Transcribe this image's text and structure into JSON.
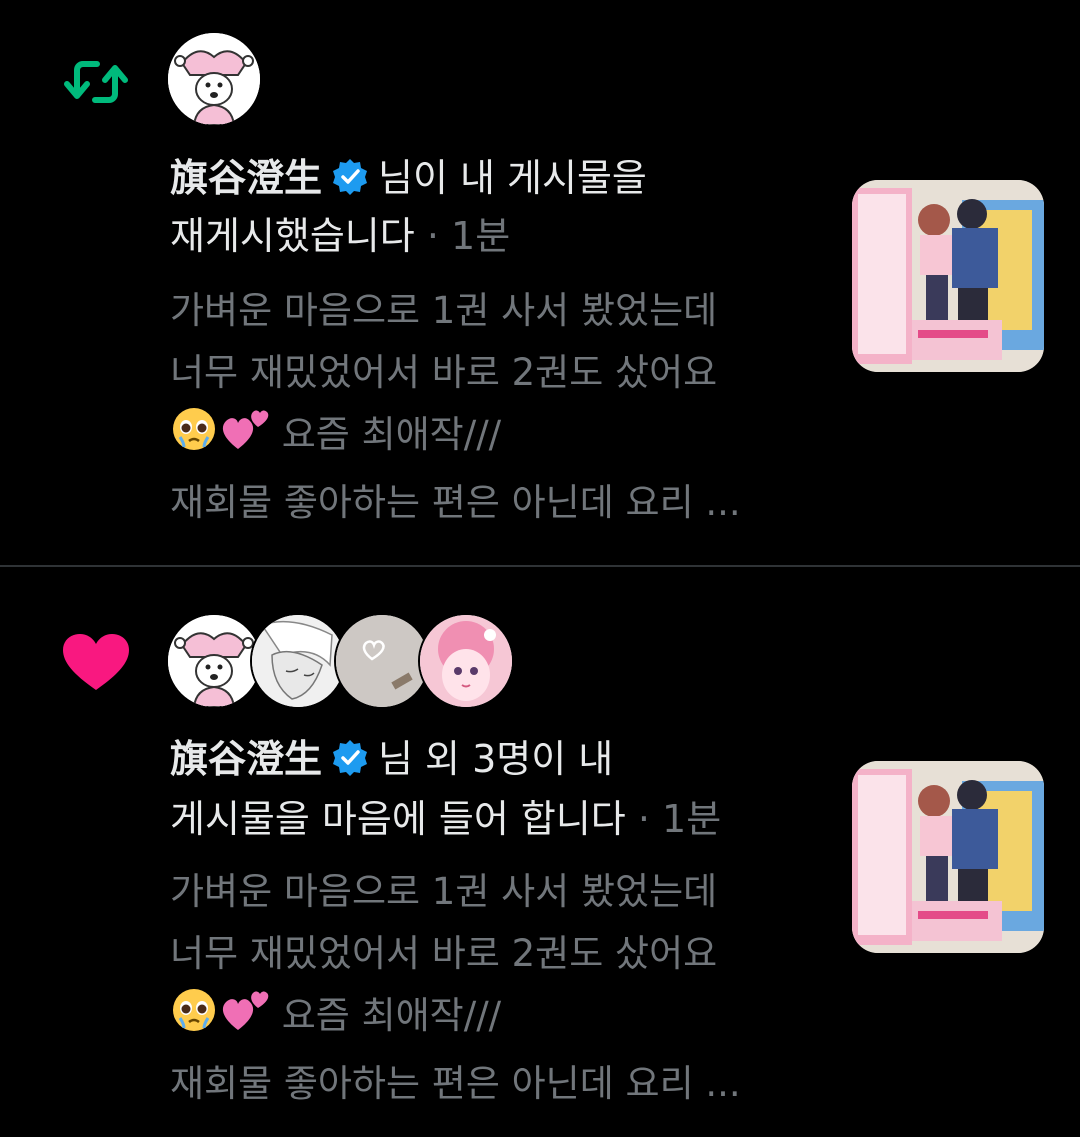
{
  "notifications": [
    {
      "type": "repost",
      "type_icon": "repost-icon",
      "actor_name": "旗谷澄生",
      "verified": true,
      "action_text_1": "님이 내 게시물을",
      "action_text_2": "재게시했습니다",
      "time": "1분",
      "preview_lines": [
        "가벼운 마음으로 1권 사서 봤었는데",
        "너무 재밌었어서 바로 2권도 샀어요",
        "요즘 최애작///",
        "재회물 좋아하는 편은 아닌데 요리 ..."
      ],
      "preview_emojis": [
        "pleading-face-emoji",
        "two-hearts-emoji"
      ]
    },
    {
      "type": "like",
      "type_icon": "heart-icon",
      "actor_name": "旗谷澄生",
      "verified": true,
      "action_text_1": "님 외 3명이 내",
      "action_text_2": "게시물을 마음에 들어 합니다",
      "time": "1분",
      "preview_lines": [
        "가벼운 마음으로 1권 사서 봤었는데",
        "너무 재밌었어서 바로 2권도 샀어요",
        "요즘 최애작///",
        "재회물 좋아하는 편은 아닌데 요리 ..."
      ],
      "preview_emojis": [
        "pleading-face-emoji",
        "two-hearts-emoji"
      ]
    }
  ],
  "separator": "·",
  "colors": {
    "background": "#000000",
    "primary_text": "#e7e9ea",
    "secondary_text": "#71767b",
    "repost_green": "#00ba7c",
    "like_pink": "#f91880",
    "verified_blue": "#1d9bf0",
    "divider": "#2f3336"
  }
}
